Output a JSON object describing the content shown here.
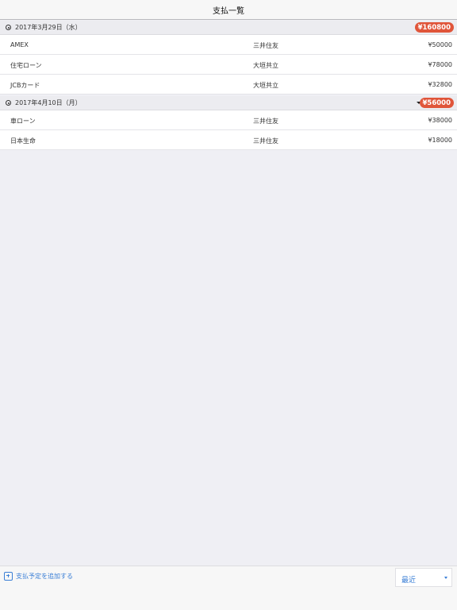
{
  "navbar": {
    "title": "支払一覧"
  },
  "sections": [
    {
      "date": "2017年3月29日（水）",
      "total": "¥160800",
      "items": [
        {
          "name": "AMEX",
          "bank": "三井住友",
          "amount": "¥50000"
        },
        {
          "name": "住宅ローン",
          "bank": "大垣共立",
          "amount": "¥78000"
        },
        {
          "name": "JCBカード",
          "bank": "大垣共立",
          "amount": "¥32800"
        }
      ]
    },
    {
      "date": "2017年4月10日（月）",
      "total": "¥56000",
      "items": [
        {
          "name": "車ローン",
          "bank": "三井住友",
          "amount": "¥38000"
        },
        {
          "name": "日本生命",
          "bank": "三井住友",
          "amount": "¥18000"
        }
      ]
    }
  ],
  "toolbar": {
    "add_label": "支払予定を追加する",
    "sort_value": "最近"
  },
  "colors": {
    "accent": "#3b7fd6",
    "total_badge": "#e0553a",
    "background": "#efeff4"
  }
}
